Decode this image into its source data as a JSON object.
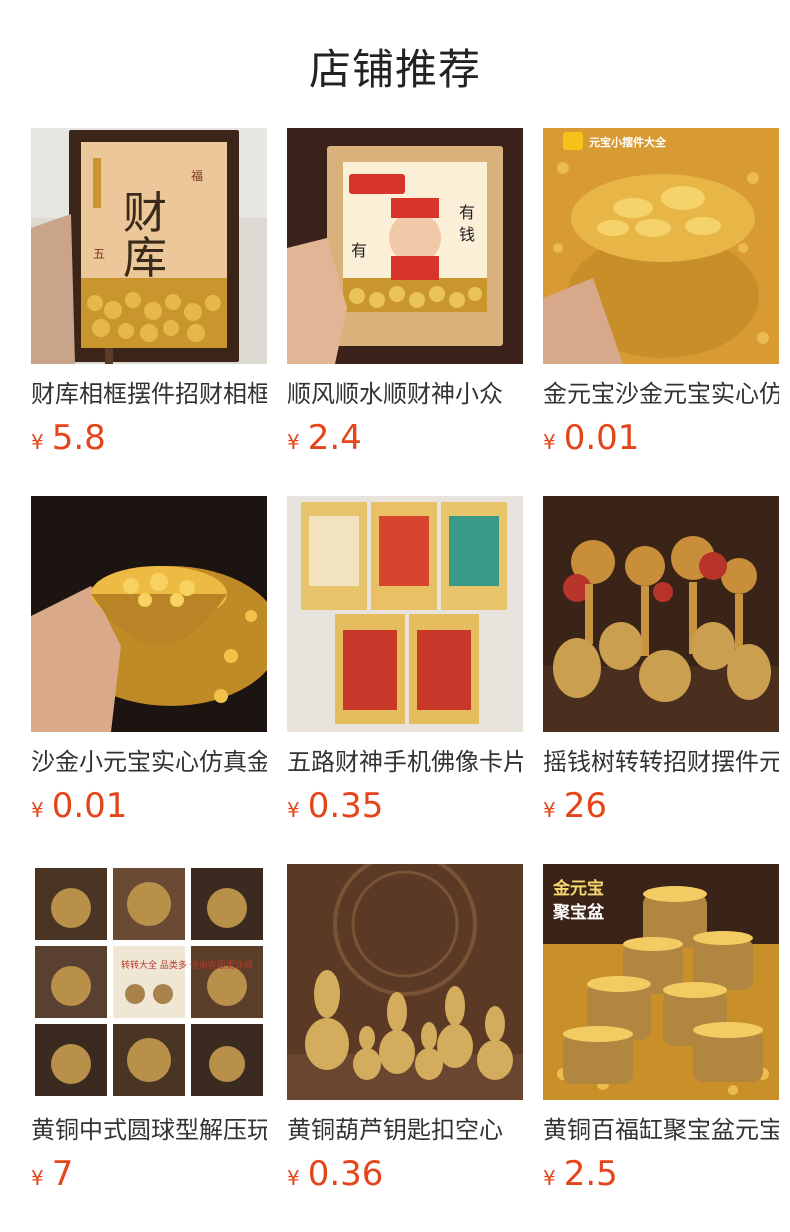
{
  "header": {
    "title": "店铺推荐"
  },
  "currency_symbol": "¥",
  "products": [
    {
      "name": "财库相框摆件招财相框",
      "price": "5.8",
      "image_icon": "caiku-frame-photo",
      "overlay_text": ""
    },
    {
      "name": "顺风顺水顺财神小众",
      "price": "2.4",
      "image_icon": "caishen-frame-photo",
      "overlay_text": ""
    },
    {
      "name": "金元宝沙金元宝实心仿真",
      "price": "0.01",
      "image_icon": "gold-ingot-bowl-photo",
      "overlay_text": "元宝小摆件大全"
    },
    {
      "name": "沙金小元宝实心仿真金",
      "price": "0.01",
      "image_icon": "gold-sand-bowl-photo",
      "overlay_text": ""
    },
    {
      "name": "五路财神手机佛像卡片",
      "price": "0.35",
      "image_icon": "buddha-cards-photo",
      "overlay_text": ""
    },
    {
      "name": "摇钱树转转招财摆件元宝",
      "price": "26",
      "image_icon": "money-tree-photo",
      "overlay_text": ""
    },
    {
      "name": "黄铜中式圆球型解压玩具",
      "price": "7",
      "image_icon": "brass-fidget-photo",
      "overlay_text": "转转大全 品类多 咨询客服更详细"
    },
    {
      "name": "黄铜葫芦钥匙扣空心",
      "price": "0.36",
      "image_icon": "brass-gourd-photo",
      "overlay_text": ""
    },
    {
      "name": "黄铜百福缸聚宝盆元宝",
      "price": "2.5",
      "image_icon": "treasure-bowl-photo",
      "overlay_text": "金元宝 聚宝盆"
    }
  ]
}
